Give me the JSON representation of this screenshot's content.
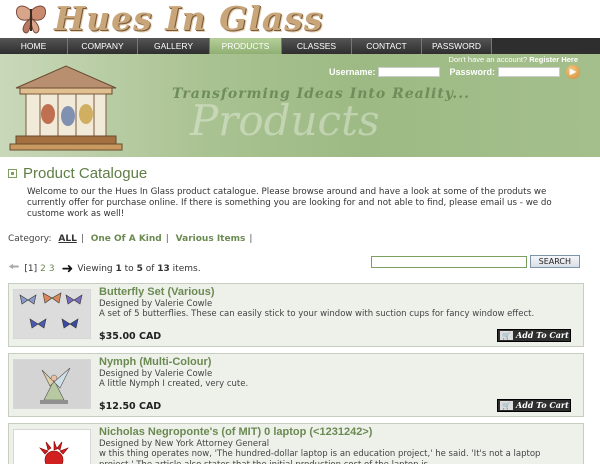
{
  "site": {
    "logo_text": "Hues In Glass"
  },
  "nav": {
    "items": [
      {
        "label": "HOME"
      },
      {
        "label": "COMPANY"
      },
      {
        "label": "GALLERY"
      },
      {
        "label": "PRODUCTS"
      },
      {
        "label": "CLASSES"
      },
      {
        "label": "CONTACT"
      },
      {
        "label": "PASSWORD"
      }
    ],
    "active": "PRODUCTS"
  },
  "banner": {
    "tagline": "Transforming Ideas Into Reality...",
    "watermark": "Products"
  },
  "account": {
    "prompt": "Don't have an account?",
    "register": "Register Here",
    "username_label": "Username:",
    "password_label": "Password:",
    "username_value": "",
    "password_value": ""
  },
  "catalogue": {
    "title": "Product Catalogue",
    "intro": "Welcome to our the Hues In Glass product catalogue. Please browse around and have a look at some of the produts we currently offer for purchase online. If there is something you are looking for and not able to find, please email us - we do custome work as well!"
  },
  "category": {
    "label": "Category:",
    "options": [
      "ALL",
      "One Of A Kind",
      "Various Items"
    ],
    "selected": "ALL"
  },
  "pager": {
    "pages": [
      "[1]",
      "2",
      "3"
    ],
    "viewing": "Viewing",
    "from": "1",
    "to_word": "to",
    "to": "5",
    "of_word": "of",
    "total": "13",
    "items_word": "items."
  },
  "search": {
    "value": "",
    "button": "SEARCH"
  },
  "products": [
    {
      "name": "Butterfly Set (Various)",
      "designer": "Designed by Valerie Cowle",
      "desc": "A set of 5 butterflies. These can easily stick to your window with suction cups for fancy window effect.",
      "price": "$35.00 CAD",
      "cart": "Add To Cart"
    },
    {
      "name": "Nymph (Multi-Colour)",
      "designer": "Designed by Valerie Cowle",
      "desc": "A little Nymph I created, very cute.",
      "price": "$12.50 CAD",
      "cart": "Add To Cart"
    },
    {
      "name": "Nicholas Negroponte's (of MIT) 0 laptop (<1231242>)",
      "designer": "Designed by New York Attorney General",
      "desc": "w this thing operates now, 'The hundred-dollar laptop is an education project,' he said. 'It's not a laptop project.' The article also states that the initial production cost of the laptop is",
      "price": "",
      "cart": ""
    }
  ]
}
